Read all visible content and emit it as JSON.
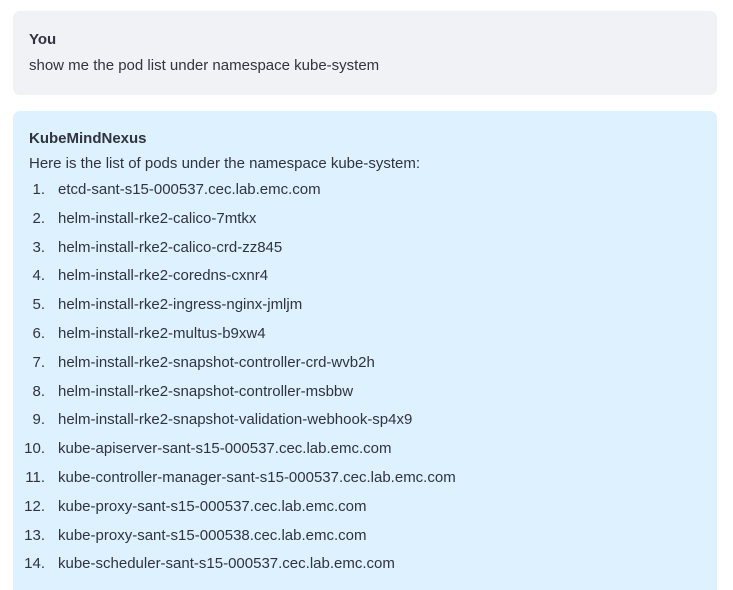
{
  "user_message": {
    "sender": "You",
    "text": "show me the pod list under namespace kube-system"
  },
  "assistant_message": {
    "sender": "KubeMindNexus",
    "intro": "Here is the list of pods under the namespace kube-system:",
    "pods": [
      {
        "num": "1.",
        "name": "etcd-sant-s15-000537.cec.lab.emc.com"
      },
      {
        "num": "2.",
        "name": "helm-install-rke2-calico-7mtkx"
      },
      {
        "num": "3.",
        "name": "helm-install-rke2-calico-crd-zz845"
      },
      {
        "num": "4.",
        "name": "helm-install-rke2-coredns-cxnr4"
      },
      {
        "num": "5.",
        "name": "helm-install-rke2-ingress-nginx-jmljm"
      },
      {
        "num": "6.",
        "name": "helm-install-rke2-multus-b9xw4"
      },
      {
        "num": "7.",
        "name": "helm-install-rke2-snapshot-controller-crd-wvb2h"
      },
      {
        "num": "8.",
        "name": "helm-install-rke2-snapshot-controller-msbbw"
      },
      {
        "num": "9.",
        "name": "helm-install-rke2-snapshot-validation-webhook-sp4x9"
      },
      {
        "num": "10.",
        "name": "kube-apiserver-sant-s15-000537.cec.lab.emc.com"
      },
      {
        "num": "11.",
        "name": "kube-controller-manager-sant-s15-000537.cec.lab.emc.com"
      },
      {
        "num": "12.",
        "name": "kube-proxy-sant-s15-000537.cec.lab.emc.com"
      },
      {
        "num": "13.",
        "name": "kube-proxy-sant-s15-000538.cec.lab.emc.com"
      },
      {
        "num": "14.",
        "name": "kube-scheduler-sant-s15-000537.cec.lab.emc.com"
      }
    ]
  },
  "colors": {
    "user_bubble": "#f0f2f6",
    "assistant_bubble": "#ddf1fe",
    "text": "#31333f"
  }
}
